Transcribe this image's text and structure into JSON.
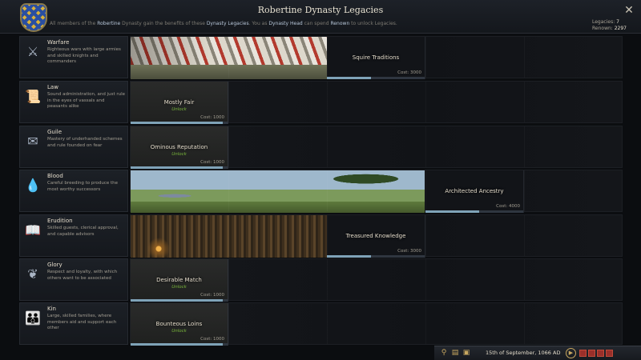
{
  "header": {
    "title": "Robertine Dynasty Legacies",
    "subtitle_prefix": "All members of the",
    "subtitle_dynasty": "Robertine",
    "subtitle_mid": "Dynasty gain the benefits of these",
    "subtitle_legacies": "Dynasty Legacies",
    "subtitle_mid2": ". You as",
    "subtitle_head": "Dynasty Head",
    "subtitle_mid3": "can spend",
    "subtitle_renown": "Renown",
    "subtitle_suffix": "to unlock Legacies.",
    "legacies_label": "Legacies:",
    "legacies_value": "7",
    "renown_label": "Renown:",
    "renown_value": "2297",
    "close_icon": "close-icon"
  },
  "rows": [
    {
      "name": "Warfare",
      "desc": "Righteous wars with large armies and skilled knights and commanders",
      "icon": "crossed-swords-icon",
      "next": {
        "name": "Squire Traditions",
        "cost": "Cost: 3000"
      }
    },
    {
      "name": "Law",
      "desc": "Sound administration, and just rule in the eyes of vassals and peasants alike",
      "icon": "scroll-icon",
      "next": {
        "name": "Mostly Fair",
        "unlock": "Unlock",
        "cost": "Cost: 1000"
      }
    },
    {
      "name": "Guile",
      "desc": "Mastery of underhanded schemes and rule founded on fear",
      "icon": "letter-icon",
      "next": {
        "name": "Ominous Reputation",
        "unlock": "Unlock",
        "cost": "Cost: 1000"
      }
    },
    {
      "name": "Blood",
      "desc": "Careful breeding to produce the most worthy successors",
      "icon": "blood-drop-icon",
      "next": {
        "name": "Architected Ancestry",
        "cost": "Cost: 4000"
      }
    },
    {
      "name": "Erudition",
      "desc": "Skilled guests, clerical approval, and capable advisors",
      "icon": "open-book-icon",
      "next": {
        "name": "Treasured Knowledge",
        "cost": "Cost: 3000"
      }
    },
    {
      "name": "Glory",
      "desc": "Respect and loyalty, with which others want to be associated",
      "icon": "laurel-icon",
      "next": {
        "name": "Desirable Match",
        "unlock": "Unlock",
        "cost": "Cost: 1000"
      }
    },
    {
      "name": "Kin",
      "desc": "Large, skilled families, where members aid and support each other",
      "icon": "family-icon",
      "next": {
        "name": "Bounteous Loins",
        "unlock": "Unlock",
        "cost": "Cost: 1000"
      }
    }
  ],
  "progress": {
    "warfare": 0.45,
    "law": 0.95,
    "guile": 0.95,
    "blood": 0.55,
    "erudition": 0.45,
    "glory": 0.95,
    "kin": 0.95
  },
  "bottombar": {
    "date": "15th of September, 1066 AD",
    "icons": [
      "magnifier-icon",
      "ledger-icon",
      "book-icon"
    ],
    "play_icon": "play-icon"
  }
}
